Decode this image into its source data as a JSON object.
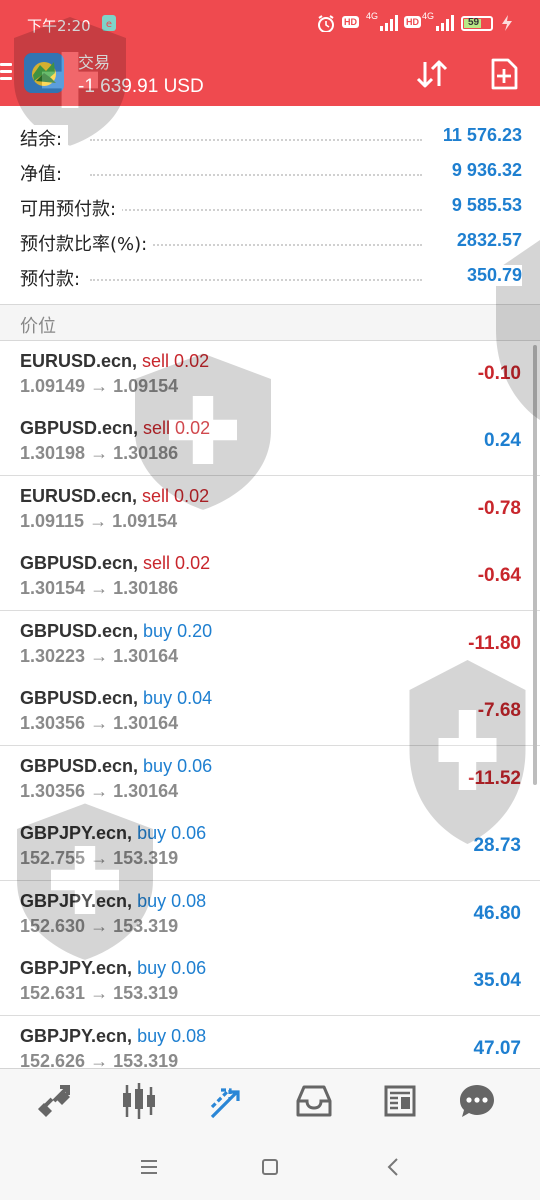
{
  "status_bar": {
    "time": "下午2:20",
    "network_1": "4G",
    "network_2": "4G",
    "hd_1": "HD",
    "hd_2": "HD",
    "battery": "59"
  },
  "header": {
    "title": "交易",
    "profit": "-1 639.91 USD",
    "colors": {
      "bar": "#ef4a4f",
      "accent_blue": "#1e7fd0",
      "loss_red": "#c8262c"
    }
  },
  "summary": [
    {
      "label": "结余:",
      "value": "11 576.23"
    },
    {
      "label": "净值:",
      "value": "9 936.32"
    },
    {
      "label": "可用预付款:",
      "value": "9 585.53"
    },
    {
      "label": "预付款比率(%):",
      "value": "2832.57"
    },
    {
      "label": "预付款:",
      "value": "350.79"
    }
  ],
  "section_label": "价位",
  "positions": [
    {
      "symbol": "EURUSD.ecn,",
      "side": "sell 0.02",
      "side_type": "sell",
      "prices": "1.09149 → 1.09154",
      "profit": "-0.10",
      "profit_type": "neg"
    },
    {
      "symbol": "GBPUSD.ecn,",
      "side": "sell 0.02",
      "side_type": "sell",
      "prices": "1.30198 → 1.30186",
      "profit": "0.24",
      "profit_type": "pos"
    },
    {
      "symbol": "EURUSD.ecn,",
      "side": "sell 0.02",
      "side_type": "sell",
      "prices": "1.09115 → 1.09154",
      "profit": "-0.78",
      "profit_type": "neg"
    },
    {
      "symbol": "GBPUSD.ecn,",
      "side": "sell 0.02",
      "side_type": "sell",
      "prices": "1.30154 → 1.30186",
      "profit": "-0.64",
      "profit_type": "neg"
    },
    {
      "symbol": "GBPUSD.ecn,",
      "side": "buy 0.20",
      "side_type": "buy",
      "prices": "1.30223 → 1.30164",
      "profit": "-11.80",
      "profit_type": "neg"
    },
    {
      "symbol": "GBPUSD.ecn,",
      "side": "buy 0.04",
      "side_type": "buy",
      "prices": "1.30356 → 1.30164",
      "profit": "-7.68",
      "profit_type": "neg"
    },
    {
      "symbol": "GBPUSD.ecn,",
      "side": "buy 0.06",
      "side_type": "buy",
      "prices": "1.30356 → 1.30164",
      "profit": "-11.52",
      "profit_type": "neg"
    },
    {
      "symbol": "GBPJPY.ecn,",
      "side": "buy 0.06",
      "side_type": "buy",
      "prices": "152.755 → 153.319",
      "profit": "28.73",
      "profit_type": "pos"
    },
    {
      "symbol": "GBPJPY.ecn,",
      "side": "buy 0.08",
      "side_type": "buy",
      "prices": "152.630 → 153.319",
      "profit": "46.80",
      "profit_type": "pos"
    },
    {
      "symbol": "GBPJPY.ecn,",
      "side": "buy 0.06",
      "side_type": "buy",
      "prices": "152.631 → 153.319",
      "profit": "35.04",
      "profit_type": "pos"
    },
    {
      "symbol": "GBPJPY.ecn,",
      "side": "buy 0.08",
      "side_type": "buy",
      "prices": "152.626 → 153.319",
      "profit": "47.07",
      "profit_type": "pos"
    }
  ],
  "tabs": [
    {
      "icon": "quotes-icon",
      "active": false
    },
    {
      "icon": "chart-candles-icon",
      "active": false
    },
    {
      "icon": "trade-icon",
      "active": true
    },
    {
      "icon": "history-inbox-icon",
      "active": false
    },
    {
      "icon": "news-icon",
      "active": false
    },
    {
      "icon": "chat-icon",
      "active": false
    }
  ],
  "system_nav": [
    {
      "icon": "recent-apps-icon"
    },
    {
      "icon": "home-icon"
    },
    {
      "icon": "back-icon"
    }
  ]
}
